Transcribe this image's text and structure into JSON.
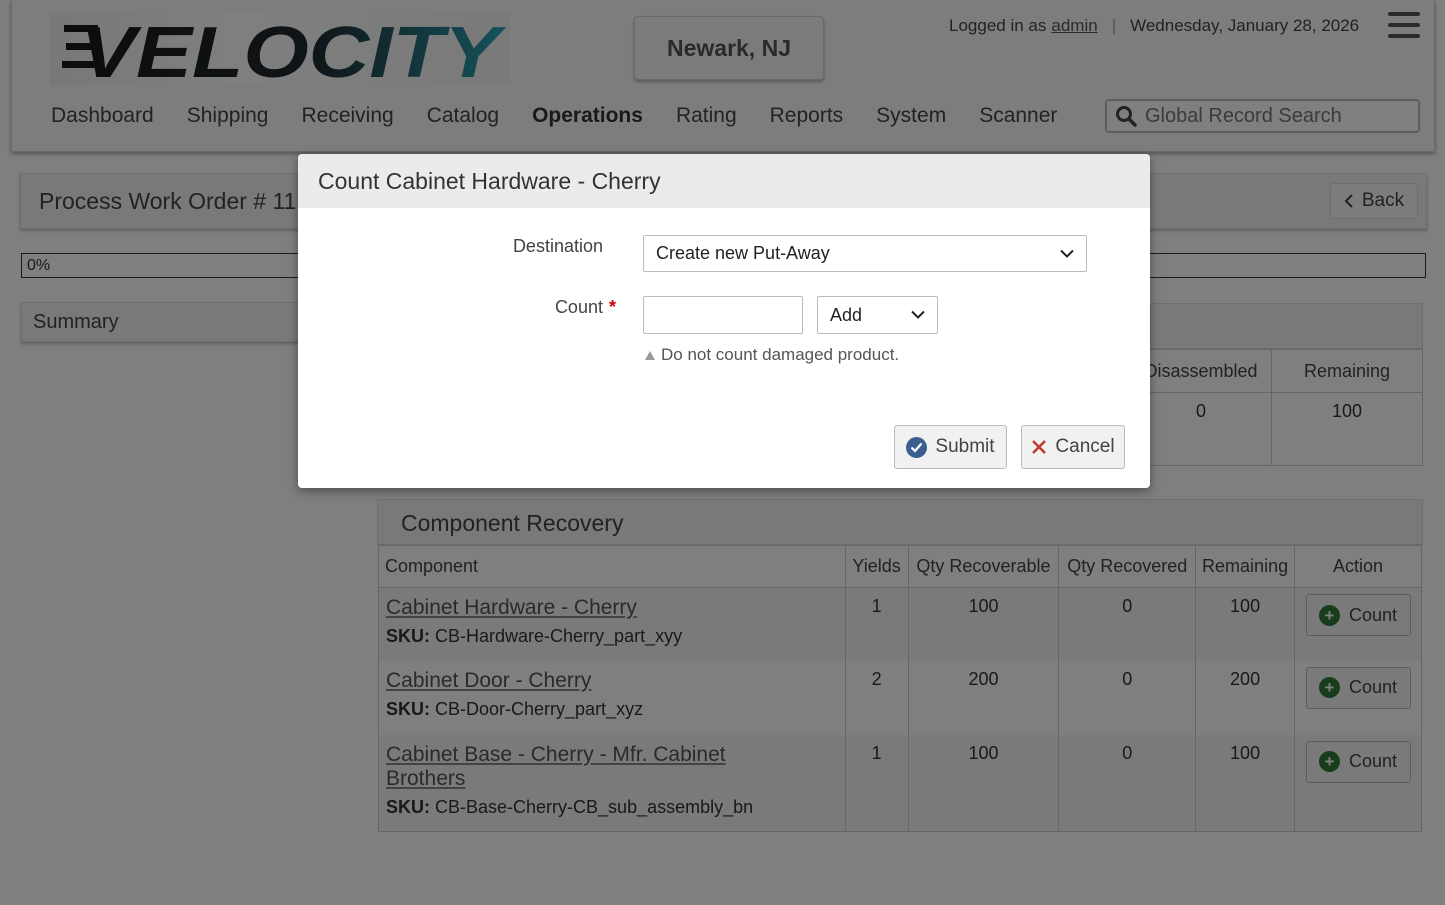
{
  "header": {
    "logo_text": "VELOCITY",
    "location": "Newark, NJ",
    "logged_in_prefix": "Logged in as",
    "username": "admin",
    "date": "Wednesday, January 28, 2026",
    "search_placeholder": "Global Record Search"
  },
  "nav": {
    "items": [
      {
        "label": "Dashboard"
      },
      {
        "label": "Shipping"
      },
      {
        "label": "Receiving"
      },
      {
        "label": "Catalog"
      },
      {
        "label": "Operations",
        "active": true
      },
      {
        "label": "Rating"
      },
      {
        "label": "Reports"
      },
      {
        "label": "System"
      },
      {
        "label": "Scanner"
      }
    ]
  },
  "page": {
    "title": "Process Work Order # 11",
    "back_label": "Back",
    "progress_text": "0%",
    "progress_value": 0,
    "summary_title": "Summary"
  },
  "disassembly": {
    "headers": [
      "Disassembled",
      "Remaining"
    ],
    "row": [
      "0",
      "100"
    ]
  },
  "recovery": {
    "title": "Component Recovery",
    "headers": [
      "Component",
      "Yields",
      "Qty Recoverable",
      "Qty Recovered",
      "Remaining",
      "Action"
    ],
    "sku_label": "SKU:",
    "action_label": "Count",
    "rows": [
      {
        "name": "Cabinet Hardware - Cherry",
        "sku": "CB-Hardware-Cherry_part_xyy",
        "yields": "1",
        "recoverable": "100",
        "recovered": "0",
        "remaining": "100"
      },
      {
        "name": "Cabinet Door - Cherry",
        "sku": "CB-Door-Cherry_part_xyz",
        "yields": "2",
        "recoverable": "200",
        "recovered": "0",
        "remaining": "200"
      },
      {
        "name": "Cabinet Base - Cherry - Mfr. Cabinet Brothers",
        "sku": "CB-Base-Cherry-CB_sub_assembly_bn",
        "yields": "1",
        "recoverable": "100",
        "recovered": "0",
        "remaining": "100"
      }
    ]
  },
  "modal": {
    "title": "Count Cabinet Hardware - Cherry",
    "destination_label": "Destination",
    "destination_value": "Create new Put-Away",
    "count_label": "Count",
    "required_mark": "*",
    "count_value": "",
    "mode_value": "Add",
    "hint": "Do not count damaged product.",
    "submit_label": "Submit",
    "cancel_label": "Cancel"
  },
  "colors": {
    "overlay": "#000000",
    "submit_icon": "#3a5f8f",
    "cancel_icon": "#c0392b",
    "count_icon": "#2f7a3a",
    "required": "#cc0000"
  }
}
